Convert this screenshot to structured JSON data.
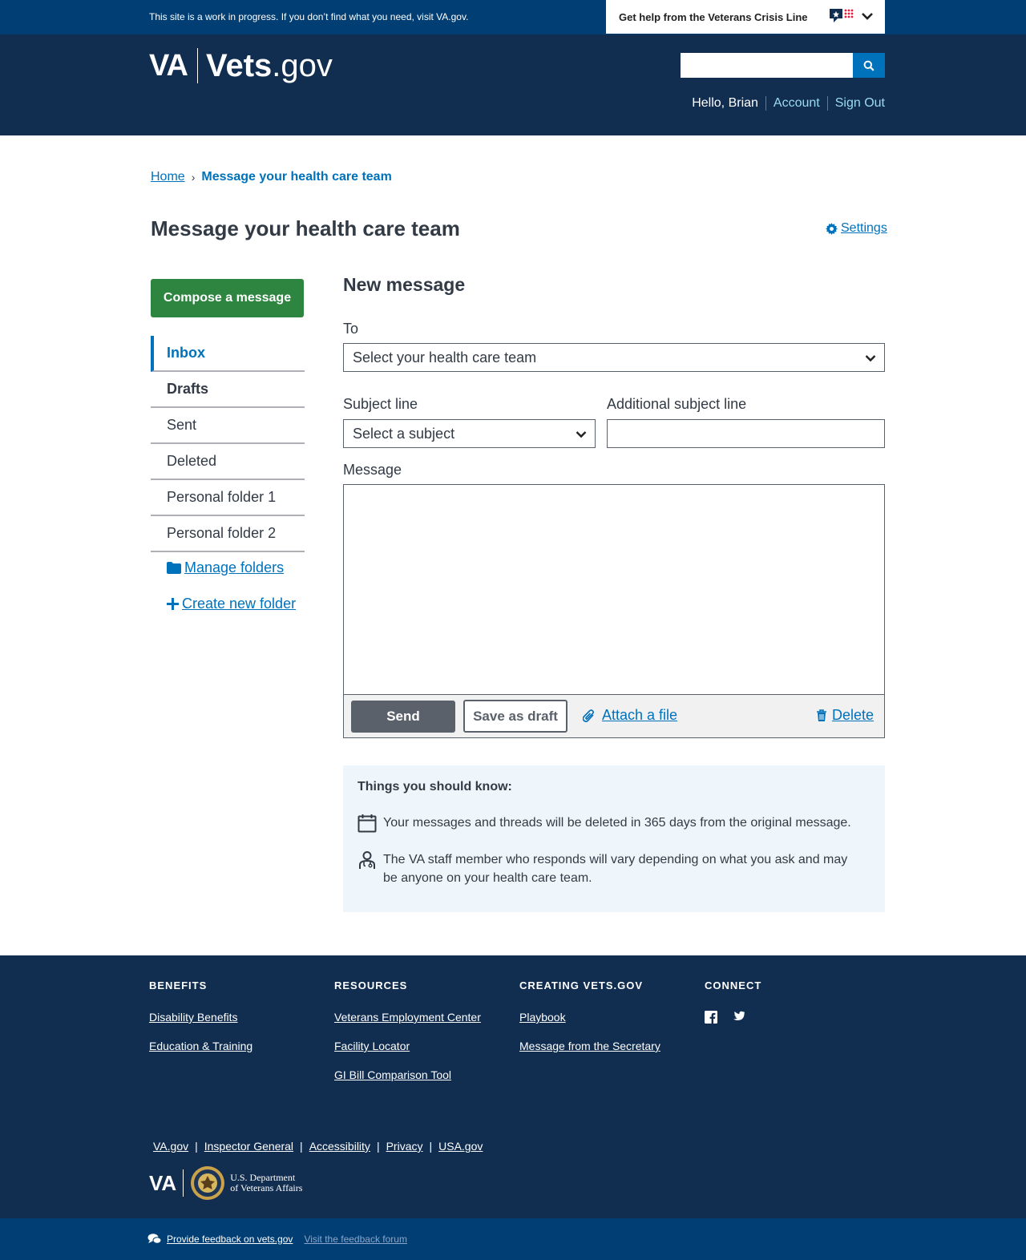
{
  "banner": {
    "notice": "This site is a work in progress. If you don’t find what you need, visit VA.gov.",
    "crisis_line": "Get help from the Veterans Crisis Line"
  },
  "header": {
    "logo_va": "VA",
    "logo_vets": "Vets",
    "logo_gov": ".gov",
    "search_placeholder": "",
    "greeting": "Hello, Brian",
    "account": "Account",
    "sign_out": "Sign Out"
  },
  "breadcrumb": {
    "home": "Home",
    "separator": "›",
    "current": "Message your health care team"
  },
  "page": {
    "title": "Message your health care team",
    "settings": "Settings"
  },
  "sidebar": {
    "compose": "Compose a message",
    "items": [
      {
        "label": "Inbox"
      },
      {
        "label": "Drafts"
      },
      {
        "label": "Sent"
      },
      {
        "label": "Deleted"
      },
      {
        "label": "Personal folder 1"
      },
      {
        "label": "Personal folder 2"
      }
    ],
    "manage_folders": "Manage folders",
    "create_folder": "Create new folder"
  },
  "form": {
    "title": "New message",
    "to_label": "To",
    "to_value": "Select your health care team",
    "subject_label": "Subject line",
    "subject_value": "Select a subject",
    "additional_label": "Additional subject line",
    "additional_value": "",
    "message_label": "Message",
    "message_value": "",
    "send": "Send",
    "save_draft": "Save as draft",
    "attach": "Attach a file",
    "delete": "Delete"
  },
  "info": {
    "title": "Things you should know:",
    "items": [
      "Your messages and threads will be deleted in 365 days from the original message.",
      "The VA staff member who responds will vary depending on what you ask and may be anyone on your health care team."
    ]
  },
  "footer": {
    "columns": [
      {
        "heading": "BENEFITS",
        "links": [
          "Disability Benefits",
          "Education & Training"
        ]
      },
      {
        "heading": "RESOURCES",
        "links": [
          "Veterans Employment Center",
          "Facility Locator",
          "GI Bill Comparison Tool"
        ]
      },
      {
        "heading": "CREATING VETS.GOV",
        "links": [
          "Playbook",
          "Message from the Secretary"
        ]
      },
      {
        "heading": "CONNECT",
        "links": []
      }
    ],
    "bottom_links": [
      "VA.gov",
      "Inspector General",
      "Accessibility",
      "Privacy",
      "USA.gov"
    ],
    "logo_va": "VA",
    "dept_line1": "U.S. Department",
    "dept_line2": "of Veterans Affairs",
    "pipe": "|"
  },
  "feedback": {
    "provide": "Provide feedback on vets.gov",
    "forum": "Visit the feedback forum"
  },
  "colors": {
    "header_bg": "#112e51",
    "banner_bg": "#003e73",
    "primary_link": "#0071bb",
    "compose_green": "#2e8540",
    "send_gray": "#5b616b",
    "info_bg": "#eff6fb"
  }
}
